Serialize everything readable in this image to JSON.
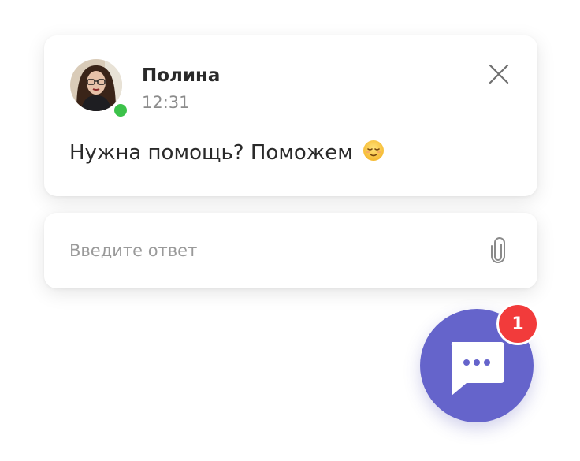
{
  "chat_popup": {
    "sender_name": "Полина",
    "sent_time": "12:31",
    "message": "Нужна помощь? Поможем",
    "message_emoji": "relieved-face-emoji",
    "operator_online": true,
    "close_icon": "close-icon"
  },
  "reply": {
    "placeholder": "Введите ответ",
    "value": "",
    "attach_icon": "paperclip-icon"
  },
  "launcher": {
    "icon": "chat-bubble-icon",
    "unread_count": "1"
  },
  "colors": {
    "accent": "#6564cb",
    "badge": "#f23b3b",
    "online": "#3cc24a",
    "text": "#2a2a2a",
    "muted": "#8c8c8c"
  }
}
